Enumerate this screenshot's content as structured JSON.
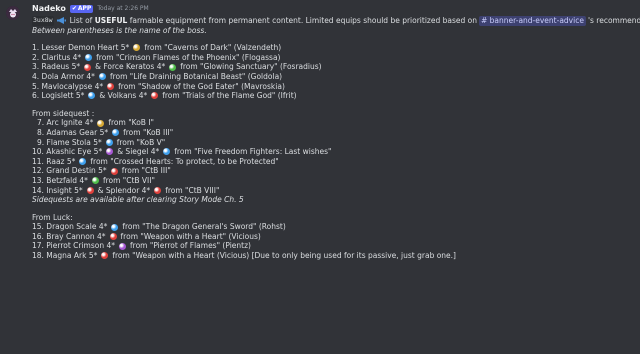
{
  "header": {
    "username": "Nadeko",
    "badge": "APP",
    "timestamp": "Today at 2:26 PM"
  },
  "intro": {
    "code": "3ux8w",
    "pre": "List of",
    "bold": "USEFUL",
    "post": "farmable equipment from permanent content. Limited equips should be prioritized based on",
    "channel": "# banner-and-event-advice",
    "end": "'s recommendations.",
    "note": "Between parentheses is the name of the boss."
  },
  "colors": {
    "wind": "#d7a833",
    "water": "#3ea0ee",
    "fire": "#e0403b",
    "earth": "#4fbd4a",
    "dark": "#a657d3"
  },
  "permanent": [
    {
      "a": "1. Lesser Demon Heart 5*",
      "o1": "wind",
      "b": "from \"Caverns of Dark\" (Valzendeth)"
    },
    {
      "a": "2. Claritus 4*",
      "o1": "water",
      "b": "from \"Crimson Flames of the Phoenix\" (Flogassa)"
    },
    {
      "a": "3. Radeus 5*",
      "o1": "fire",
      "m": "& Force Keratos 4*",
      "o2": "earth",
      "b": "from \"Glowing Sanctuary\" (Fosradius)"
    },
    {
      "a": "4. Dola Armor 4*",
      "o1": "water",
      "b": "from \"Life Draining Botanical Beast\" (Goldola)"
    },
    {
      "a": "5. Mavlocalypse 4*",
      "o1": "fire",
      "b": "from \"Shadow of the God Eater\" (Mavroskia)"
    },
    {
      "a": "6. Logislett 5*",
      "o1": "water",
      "m": "& Volkans 4*",
      "o2": "fire",
      "b": "from \"Trials of the Flame God\" (Ifrit)"
    }
  ],
  "side_title": "From sidequest :",
  "side": [
    {
      "a": "7. Arc Ignite 4*",
      "o1": "wind",
      "b": "from \"KoB I\"",
      "ind": true
    },
    {
      "a": "8. Adamas Gear 5*",
      "o1": "water",
      "b": "from \"KoB III\"",
      "ind": true
    },
    {
      "a": "9. Flame Stola 5*",
      "o1": "water",
      "b": "from \"KoB V\"",
      "ind": true
    },
    {
      "a": "10. Akashic Eye 5*",
      "o1": "dark",
      "m": "& Siegel 4*",
      "o2": "water",
      "b": "from \"Five Freedom Fighters: Last wishes\""
    },
    {
      "a": "11. Raaz 5*",
      "o1": "water",
      "b": "from \"Crossed Hearts: To protect, to be Protected\""
    },
    {
      "a": "12. Grand Destin 5*",
      "o1": "fire",
      "b": "from \"CtB III\""
    },
    {
      "a": "13. Betzfald 4*",
      "o1": "earth",
      "b": "from \"CtB VII\""
    },
    {
      "a": "14. Insight 5*",
      "o1": "fire",
      "m": "& Splendor 4*",
      "o2": "fire",
      "b": "from \"CtB VIII\""
    }
  ],
  "side_note": "Sidequests are available after clearing Story Mode Ch. 5",
  "luck_title": "From Luck:",
  "luck": [
    {
      "a": "15. Dragon Scale 4*",
      "o1": "water",
      "b": "from \"The Dragon General's Sword\" (Rohst)"
    },
    {
      "a": "16. Bray Cannon 4*",
      "o1": "fire",
      "b": "from \"Weapon with a Heart\" (Vicious)"
    },
    {
      "a": "17. Pierrot Crimson 4*",
      "o1": "dark",
      "b": "from \"Pierrot of Flames\" (Pientz)"
    },
    {
      "a": "18. Magna Ark 5*",
      "o1": "fire",
      "b": "from \"Weapon with a Heart (Vicious) [Due to only being used for its passive, just grab one.]"
    }
  ]
}
